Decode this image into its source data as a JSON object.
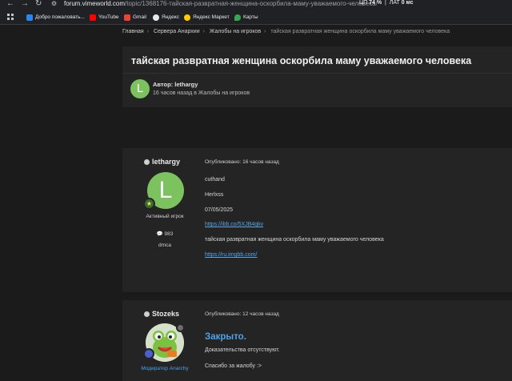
{
  "browser": {
    "url_host": "forum.vimeworld.com",
    "url_path": "/topic/1368176-тайская-развратная-женщина-оскорбила-маму-уважаемого-человека/",
    "stat_cpu": "ЦП",
    "stat_cpu_val": "74 %",
    "stat_lat": "ЛАТ",
    "stat_lat_val": "0 мс",
    "bookmarks": [
      "Добро пожаловать...",
      "YouTube",
      "Gmail",
      "Яндекс",
      "Яндекс Маркет",
      "Карты"
    ]
  },
  "breadcrumb": {
    "items": [
      "Главная",
      "Сервера Анархии",
      "Жалобы на игроков"
    ],
    "current": "тайская развратная женщина оскорбила маму уважаемого человека"
  },
  "topic": {
    "title": "тайская развратная женщина оскорбила маму уважаемого человека",
    "author_line": "Автор: lethargy",
    "meta_line": "16 часов назад в Жалобы на игроков",
    "avatar_letter": "L"
  },
  "post1": {
    "username": "lethargy",
    "avatar_letter": "L",
    "rank": "Активный игрок",
    "reputation": "983",
    "extra": "dmca",
    "published": "Опубликовано: 16 часов назад",
    "lines": [
      "cuthand",
      "Herlxss",
      "07/05/2025"
    ],
    "link1": "https://ibb.co/5XJB4qkv",
    "body": "тайская развратная женщина оскорбила маму уважаемого человека",
    "link2": "https://ru.imgbb.com/"
  },
  "post2": {
    "username": "Stozeks",
    "rank": "Модератор Anarchy",
    "published": "Опубликовано: 12 часов назад",
    "closed": "Закрыто.",
    "reason": "Доказательства отсутствуют.",
    "thanks": "Спасибо за жалобу :>"
  },
  "colors": {
    "accent_link": "#5aa6e6",
    "avatar_green": "#7cc360",
    "closed_blue": "#4da2ea"
  }
}
